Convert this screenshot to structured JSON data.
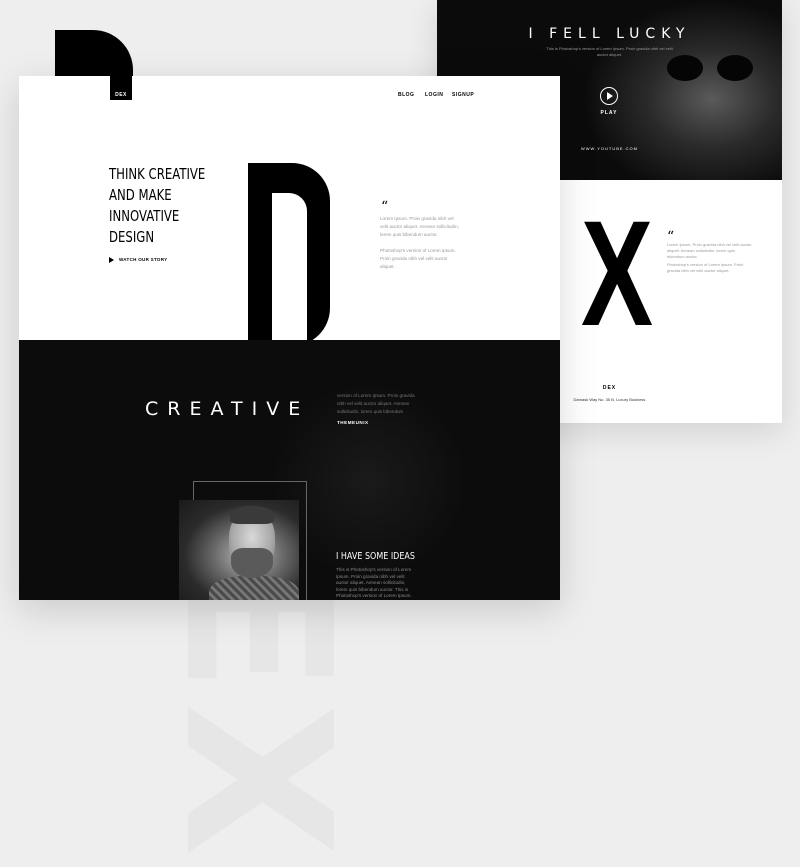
{
  "watermark": "DEX",
  "right_card": {
    "title": "I FELL LUCKY",
    "subtitle": "This is Photoshop's version of Lorem Ipsum. Proin gravida nibh vel velit auctor aliquet.",
    "play_label": "PLAY",
    "url": "WWW.YOUTUBE.COM",
    "big_letter": "X",
    "quote_mark": "“",
    "text_1": "Lorem Ipsum. Proin gravida nibh vel velit auctor aliquet. Aenean sollicitudin, lorem quis bibendum auctor.",
    "text_2": "Photoshop's version of Lorem Ipsum. Proin gravida nibh vel velit auctor aliquet.",
    "brand": "DEX",
    "address": "Damask Way No. 35 B, Luxury Business"
  },
  "main_card": {
    "logo": "DEX",
    "nav": [
      "BLOG",
      "LOGIN",
      "SIGNUP"
    ],
    "headline": [
      "THINK CREATIVE",
      "AND MAKE",
      "INNOVATIVE",
      "DESIGN"
    ],
    "watch_label": "WATCH OUR STORY",
    "quote_mark": "“",
    "paragraph_1": "Lorem Ipsum. Proin gravida nibh vel velit auctor aliquet. Aenean sollicitudin, lorem quis bibendum auctor.",
    "paragraph_2": "Photoshop's version of Lorem Ipsum. Proin gravida nibh vel velit auctor aliquet.",
    "creative_title": "CREATIVE",
    "creative_text": "version of Lorem Ipsum. Proin gravida nibh vel velit auctor aliquet. Aenean sollicitudin, lorem quis bibendum",
    "brand": "THEMEUNIX",
    "ideas_title": "I HAVE SOME IDEAS",
    "ideas_text": "This is Photoshop's version of Lorem Ipsum. Proin gravida nibh vel velit auctor aliquet. Aenean sollicitudin, lorem quis bibendum auctor. This is Photoshop's version of Lorem Ipsum. Proin gravida nibh vel velit auctor aliquet. Aenean sollicitudin"
  },
  "colors": {
    "primary": "#000000",
    "background": "#eeeeee",
    "dark_panel": "#0c0c0c",
    "muted_text": "#999999"
  },
  "icons": [
    "play-icon",
    "triangle-play-icon",
    "quote-icon"
  ]
}
